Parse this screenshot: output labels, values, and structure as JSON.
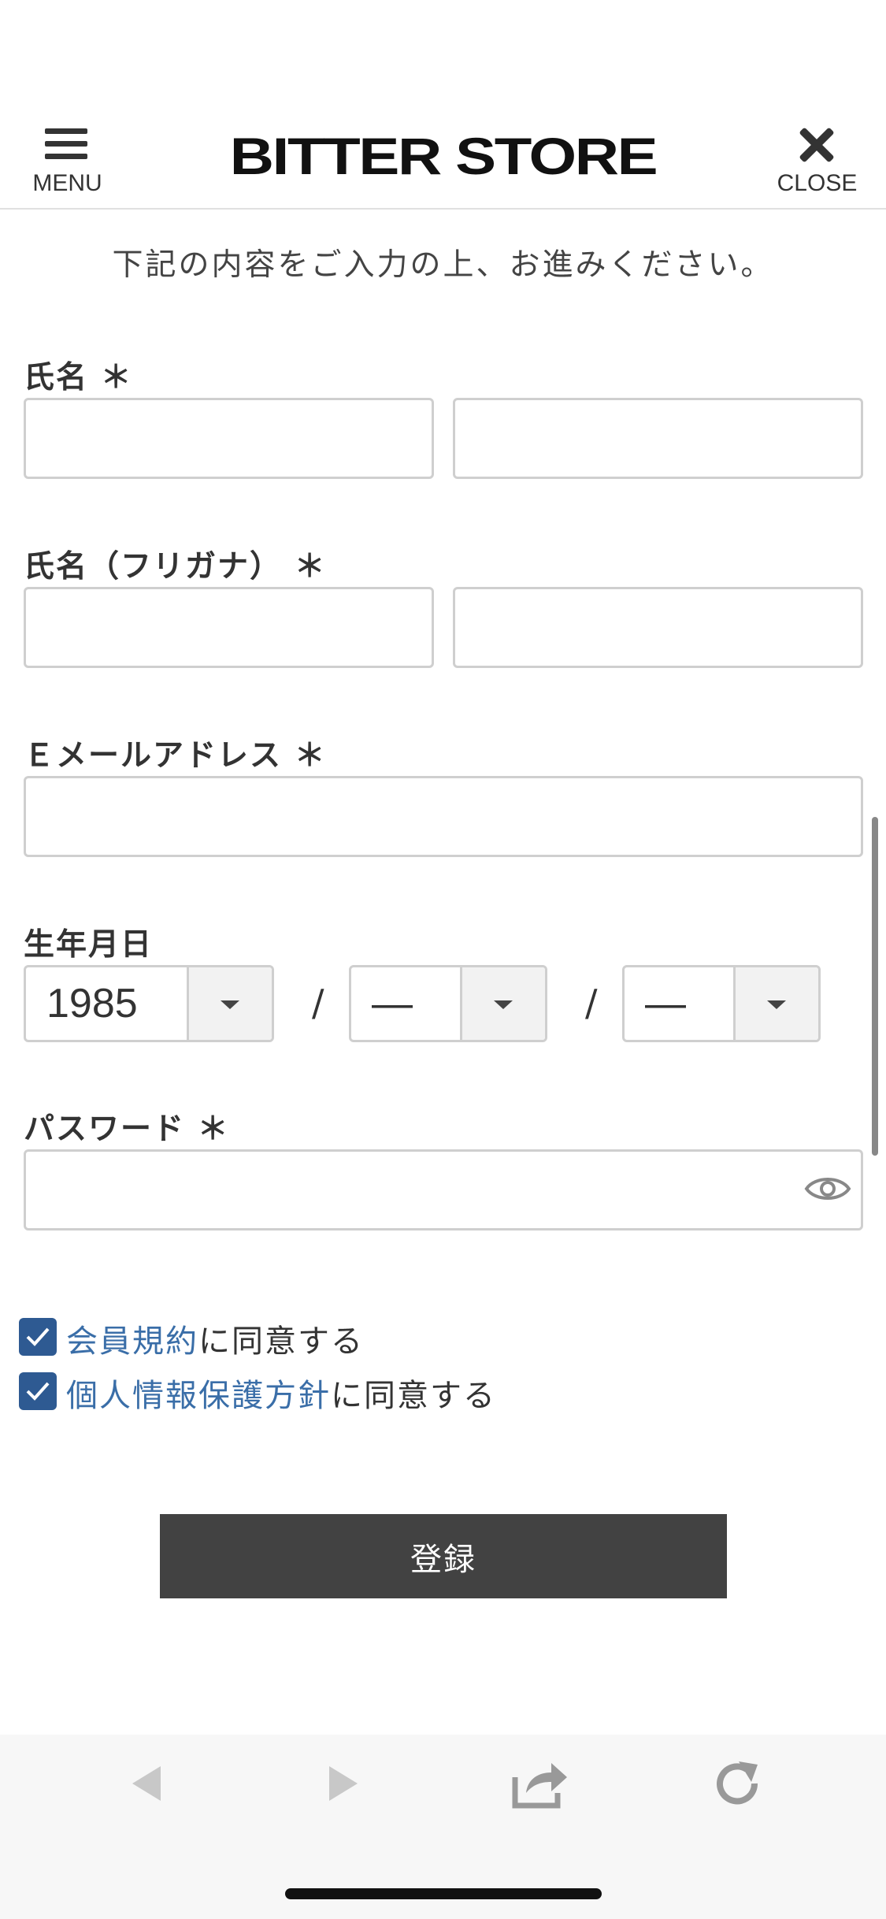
{
  "header": {
    "menu_label": "MENU",
    "logo": "BITTER STORE",
    "close_label": "CLOSE"
  },
  "intro": "下記の内容をご入力の上、お進みください。",
  "form": {
    "name_label": "氏名 ＊",
    "kana_label": "氏名（フリガナ） ＊",
    "email_label": "Ｅメールアドレス ＊",
    "birth_label": "生年月日",
    "birth_year": "1985",
    "birth_month": "—",
    "birth_day": "—",
    "separator": "/",
    "password_label": "パスワード ＊"
  },
  "agreements": [
    {
      "link": "会員規約",
      "text": "に同意する",
      "checked": true
    },
    {
      "link": "個人情報保護方針",
      "text": "に同意する",
      "checked": true
    }
  ],
  "submit_label": "登録",
  "toolbar": {
    "icons": [
      "back-arrow-icon",
      "forward-arrow-icon",
      "share-icon",
      "reload-icon"
    ]
  },
  "colors": {
    "accent": "#2e5a92",
    "link": "#3a6ea8",
    "button": "#424242"
  }
}
